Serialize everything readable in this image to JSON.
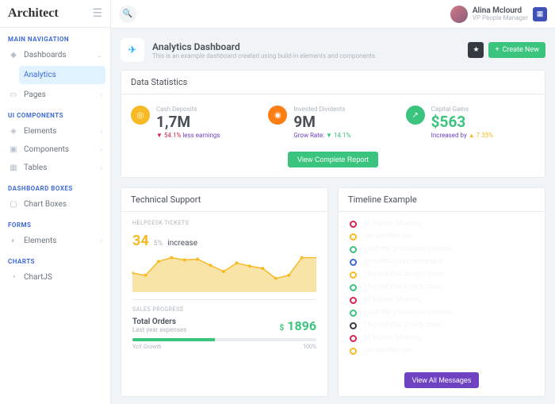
{
  "brand": "Architect",
  "nav": {
    "headers": [
      "MAIN NAVIGATION",
      "UI COMPONENTS",
      "DASHBOARD BOXES",
      "FORMS",
      "CHARTS"
    ],
    "dashboards": "Dashboards",
    "analytics": "Analytics",
    "pages": "Pages",
    "elements": "Elements",
    "components": "Components",
    "tables": "Tables",
    "chartboxes": "Chart Boxes",
    "formElements": "Elements",
    "chartjs": "ChartJS"
  },
  "user": {
    "name": "Alina Mclourd",
    "role": "VP People Manager"
  },
  "page": {
    "title": "Analytics Dashboard",
    "sub": "This is an example dashboard created using build-in elements and components.",
    "create": "Create New"
  },
  "stats": {
    "title": "Data Statistics",
    "s1": {
      "label": "Cash Deposits",
      "value": "1,7M",
      "trend": "54.1%",
      "note": "less earnings"
    },
    "s2": {
      "label": "Invested Dividents",
      "value": "9M",
      "note": "Grow Rate:",
      "trend": "14.1%"
    },
    "s3": {
      "label": "Capital Gains",
      "value": "$563",
      "note": "Increased by",
      "trend": "7.35%"
    },
    "report": "View Complete Report"
  },
  "tech": {
    "title": "Technical Support",
    "label1": "HELPDESK TICKETS",
    "num": "34",
    "pct": "5%",
    "word": "increase",
    "label2": "SALES PROGRESS",
    "orders": "Total Orders",
    "ordersSub": "Last year expenses",
    "amount": "1896",
    "yoy": "YoY Growth",
    "yoyPct": "100%"
  },
  "timeline": {
    "title": "Timeline Example",
    "items": [
      {
        "c": "#d92550",
        "t": "All Hands Meeting"
      },
      {
        "c": "#f7b924",
        "t": "Yet another one"
      },
      {
        "c": "#3ac47d",
        "t": "Build the production release"
      },
      {
        "c": "#3f6ad8",
        "t": "Something not important"
      },
      {
        "c": "#f7b924",
        "t": "This dot has an info state"
      },
      {
        "c": "#3ac47d",
        "t": "This dot has a dark state"
      },
      {
        "c": "#d92550",
        "t": "All Hands Meeting"
      },
      {
        "c": "#3ac47d",
        "t": "Build the production release"
      },
      {
        "c": "#343a40",
        "t": "This dot has a dark state"
      },
      {
        "c": "#d92550",
        "t": "All Hands Meeting"
      },
      {
        "c": "#f7b924",
        "t": "Yet another one"
      }
    ],
    "btn": "View All Messages"
  },
  "chart_data": {
    "type": "area",
    "title": "Helpdesk Tickets",
    "x": [
      1,
      2,
      3,
      4,
      5,
      6,
      7,
      8,
      9,
      10,
      11,
      12,
      13,
      14
    ],
    "values": [
      20,
      18,
      30,
      34,
      32,
      33,
      28,
      22,
      30,
      27,
      25,
      16,
      19,
      34
    ],
    "ylim": [
      0,
      40
    ]
  }
}
